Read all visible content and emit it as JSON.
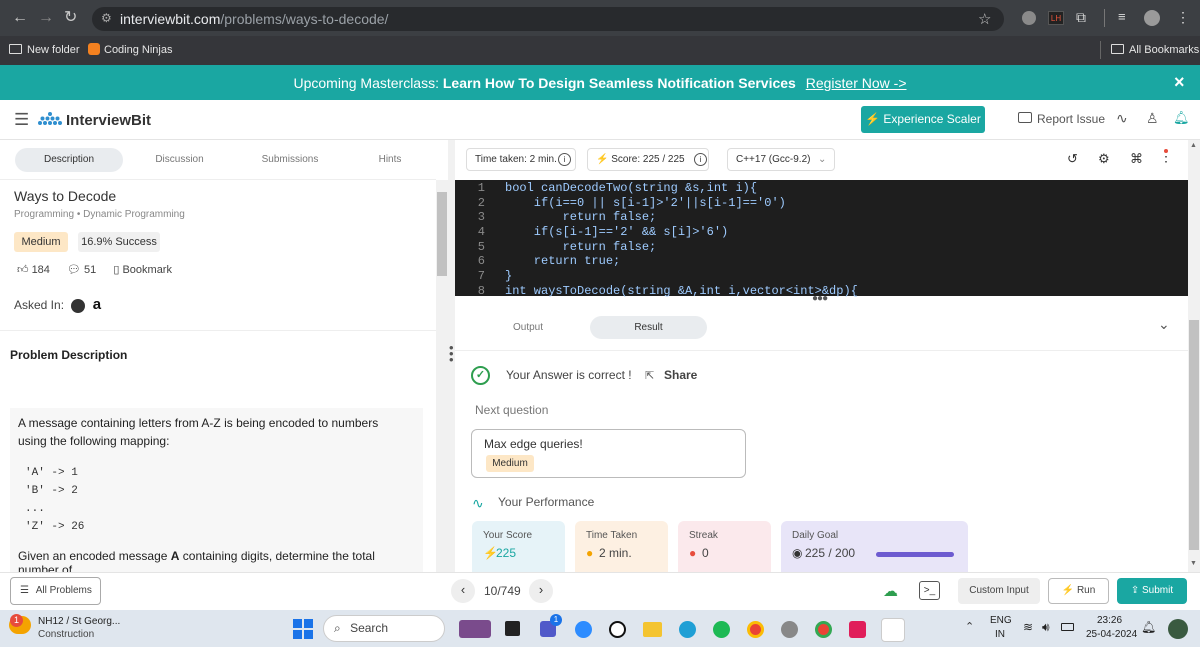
{
  "browser": {
    "url_host": "interviewbit.com",
    "url_path": "/problems/ways-to-decode/",
    "bookmarks": [
      "New folder",
      "Coding Ninjas"
    ],
    "all_bookmarks": "All Bookmarks",
    "ext_badge": "LH"
  },
  "banner": {
    "prefix": "Upcoming Masterclass: ",
    "title": "Learn How To Design Seamless Notification Services",
    "cta": "Register Now ->",
    "close": "×"
  },
  "header": {
    "logo_text": "InterviewBit",
    "experience_btn": "⚡ Experience Scaler",
    "report_issue": "Report Issue"
  },
  "left_tabs": [
    "Description",
    "Discussion",
    "Submissions",
    "Hints"
  ],
  "problem": {
    "title": "Ways to Decode",
    "breadcrumb_a": "Programming",
    "breadcrumb_sep": "•",
    "breadcrumb_b": "Dynamic Programming",
    "difficulty": "Medium",
    "success": "16.9% Success",
    "likes": "184",
    "comments": "51",
    "bookmark": "Bookmark",
    "asked_in": "Asked In:",
    "desc_heading": "Problem Description",
    "desc_p1": "A message containing letters from A-Z is being encoded to numbers using the following mapping:",
    "mapping": [
      "'A' -> 1",
      "'B' -> 2",
      "...",
      "'Z' -> 26"
    ],
    "desc_p2_a": "Given an encoded message ",
    "desc_p2_b": "A",
    "desc_p2_c": " containing digits, determine the total number of"
  },
  "editor_bar": {
    "time_taken": "Time taken: 2 min.",
    "score": "Score: 225  /  225",
    "language": "C++17 (Gcc-9.2)"
  },
  "code": {
    "lines": [
      {
        "n": "1",
        "t": "bool canDecodeTwo(string &s,int i){"
      },
      {
        "n": "2",
        "t": "    if(i==0 || s[i-1]>'2'||s[i-1]=='0')"
      },
      {
        "n": "3",
        "t": "        return false;"
      },
      {
        "n": "4",
        "t": "    if(s[i-1]=='2' && s[i]>'6')"
      },
      {
        "n": "5",
        "t": "        return false;"
      },
      {
        "n": "6",
        "t": "    return true;"
      },
      {
        "n": "7",
        "t": "}"
      },
      {
        "n": "8",
        "t": "int waysToDecode(string &A,int i,vector<int>&dp){"
      }
    ]
  },
  "result_tabs": [
    "Output",
    "Result"
  ],
  "result": {
    "message": "Your Answer is correct !",
    "share": "Share",
    "next_label": "Next question",
    "next_title": "Max edge queries!",
    "next_difficulty": "Medium",
    "performance": "Your Performance",
    "cards": [
      {
        "label": "Your Score",
        "value": "225",
        "icon": "⚡",
        "bg": "#e6f3f8"
      },
      {
        "label": "Time Taken",
        "value": "2 min.",
        "icon": "●",
        "bg": "#fdf0e2"
      },
      {
        "label": "Streak",
        "value": "0",
        "icon": "●",
        "bg": "#fbe9ec"
      },
      {
        "label": "Daily Goal",
        "value": "225 / 200",
        "icon": "◉",
        "bg": "#e8e5f8"
      }
    ],
    "daily_goal_progress": 1.0
  },
  "bottom": {
    "all_problems": "All Problems",
    "pager": "10/749",
    "custom_input": "Custom Input",
    "run": "Run",
    "submit": "Submit"
  },
  "taskbar": {
    "weather_line1": "NH12 / St Georg...",
    "weather_line2": "Construction",
    "weather_badge": "1",
    "search": "Search",
    "lang1": "ENG",
    "lang2": "IN",
    "time": "23:26",
    "date": "25-04-2024",
    "teams_badge": "1"
  }
}
